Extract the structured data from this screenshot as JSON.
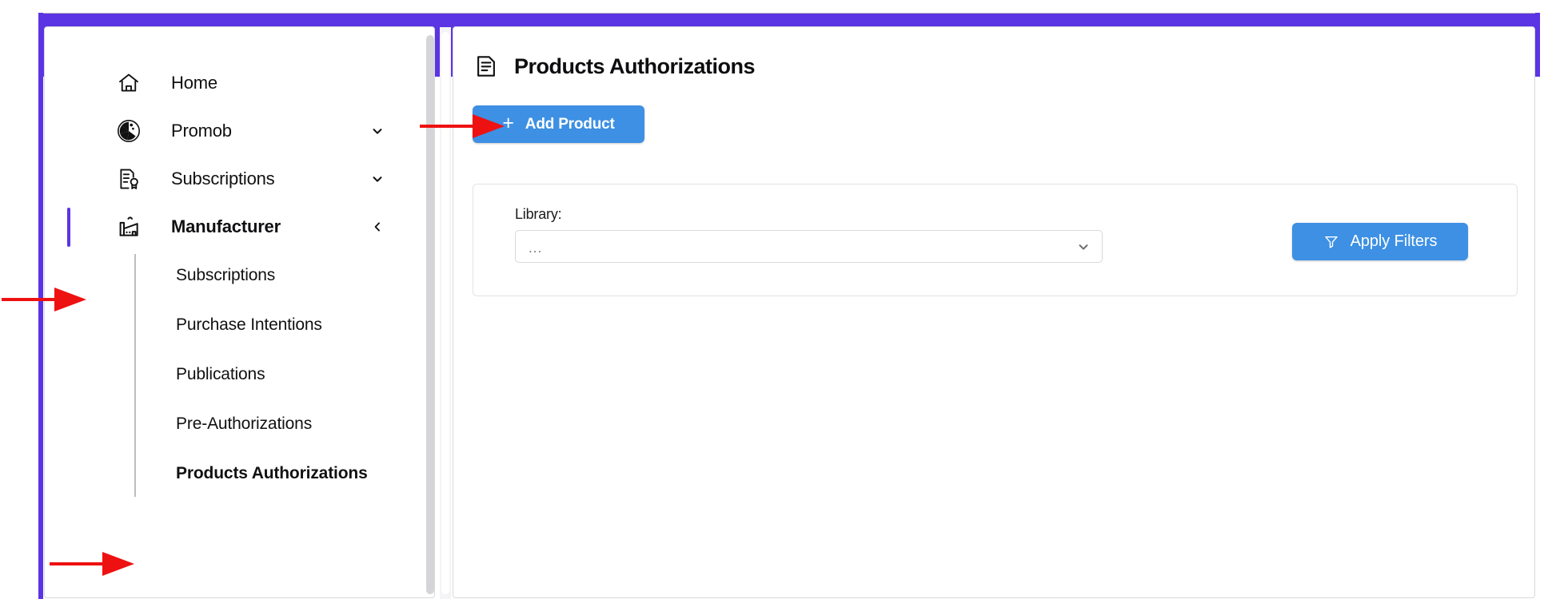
{
  "colors": {
    "purple_frame": "#5b34e3",
    "accent_purple": "#5b34e3",
    "button_blue": "#3d90e3",
    "annotation_red": "#ee1111",
    "text_dark": "#101012",
    "muted_text": "#6d6d73",
    "border": "#d9d9dd"
  },
  "sidebar": {
    "items": [
      {
        "label": "Home",
        "icon": "home-icon",
        "chevron": "",
        "active": false,
        "accent": false
      },
      {
        "label": "Promob",
        "icon": "promob-icon",
        "chevron": "chevron-down",
        "active": false,
        "accent": false
      },
      {
        "label": "Subscriptions",
        "icon": "certificate-icon",
        "chevron": "chevron-down",
        "active": false,
        "accent": false
      },
      {
        "label": "Manufacturer",
        "icon": "factory-icon",
        "chevron": "chevron-left",
        "active": true,
        "accent": true
      }
    ],
    "submenu": [
      {
        "label": "Subscriptions",
        "active": false
      },
      {
        "label": "Purchase Intentions",
        "active": false
      },
      {
        "label": "Publications",
        "active": false
      },
      {
        "label": "Pre-Authorizations",
        "active": false
      },
      {
        "label": "Products Authorizations",
        "active": true
      }
    ]
  },
  "main": {
    "page_title": "Products Authorizations",
    "page_title_icon": "document-lines-icon",
    "add_product": {
      "label": "Add Product",
      "icon": "plus-icon"
    },
    "filters": {
      "library_label": "Library:",
      "library_value": "...",
      "library_chevron_icon": "chevron-down-icon",
      "apply_label": "Apply Filters",
      "apply_icon": "funnel-icon"
    }
  },
  "annotations": [
    {
      "name": "arrow-to-manufacturer",
      "target": "Manufacturer",
      "direction": "right"
    },
    {
      "name": "arrow-to-products-auth",
      "target": "Products Authorizations",
      "direction": "right"
    },
    {
      "name": "arrow-to-add-product-button",
      "target": "Add Product",
      "direction": "right"
    }
  ]
}
